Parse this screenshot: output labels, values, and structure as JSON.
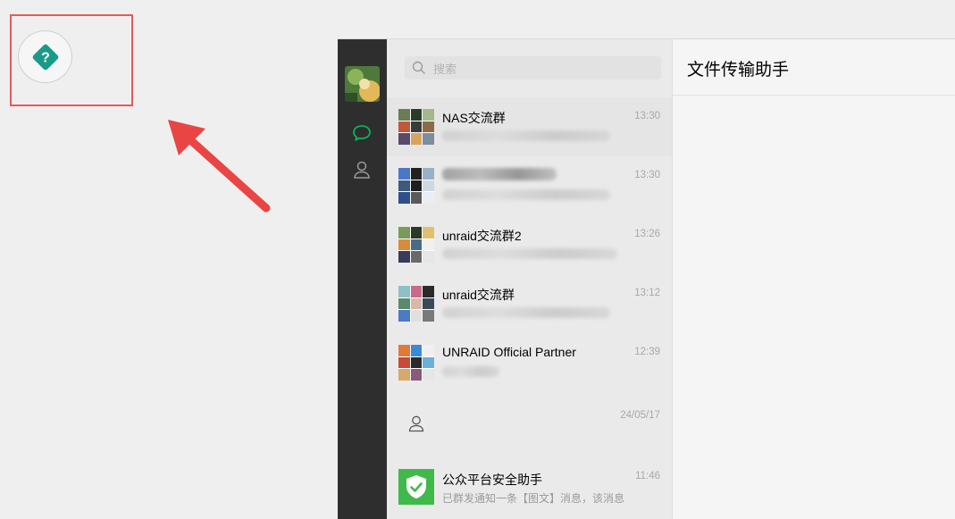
{
  "search": {
    "placeholder": "搜索"
  },
  "conversation": {
    "title": "文件传输助手"
  },
  "chats": [
    {
      "name": "NAS交流群",
      "time": "13:30",
      "preview": ""
    },
    {
      "name": "",
      "time": "13:30",
      "preview": ""
    },
    {
      "name": "unraid交流群2",
      "time": "13:26",
      "preview": ""
    },
    {
      "name": "unraid交流群",
      "time": "13:12",
      "preview": ""
    },
    {
      "name": "UNRAID Official Partner",
      "time": "12:39",
      "preview": ""
    },
    {
      "name": "",
      "time": "24/05/17",
      "preview": ""
    },
    {
      "name": "公众平台安全助手",
      "time": "11:46",
      "preview": "已群发通知一条【图文】消息，该消息"
    }
  ],
  "colors": {
    "accent": "#07c160",
    "annotation": "#e65a5a",
    "help_icon": "#1a9b8a"
  },
  "icons": [
    "help-diamond-icon",
    "chat-icon",
    "contacts-icon",
    "search-icon",
    "shield-check-icon",
    "person-icon"
  ]
}
